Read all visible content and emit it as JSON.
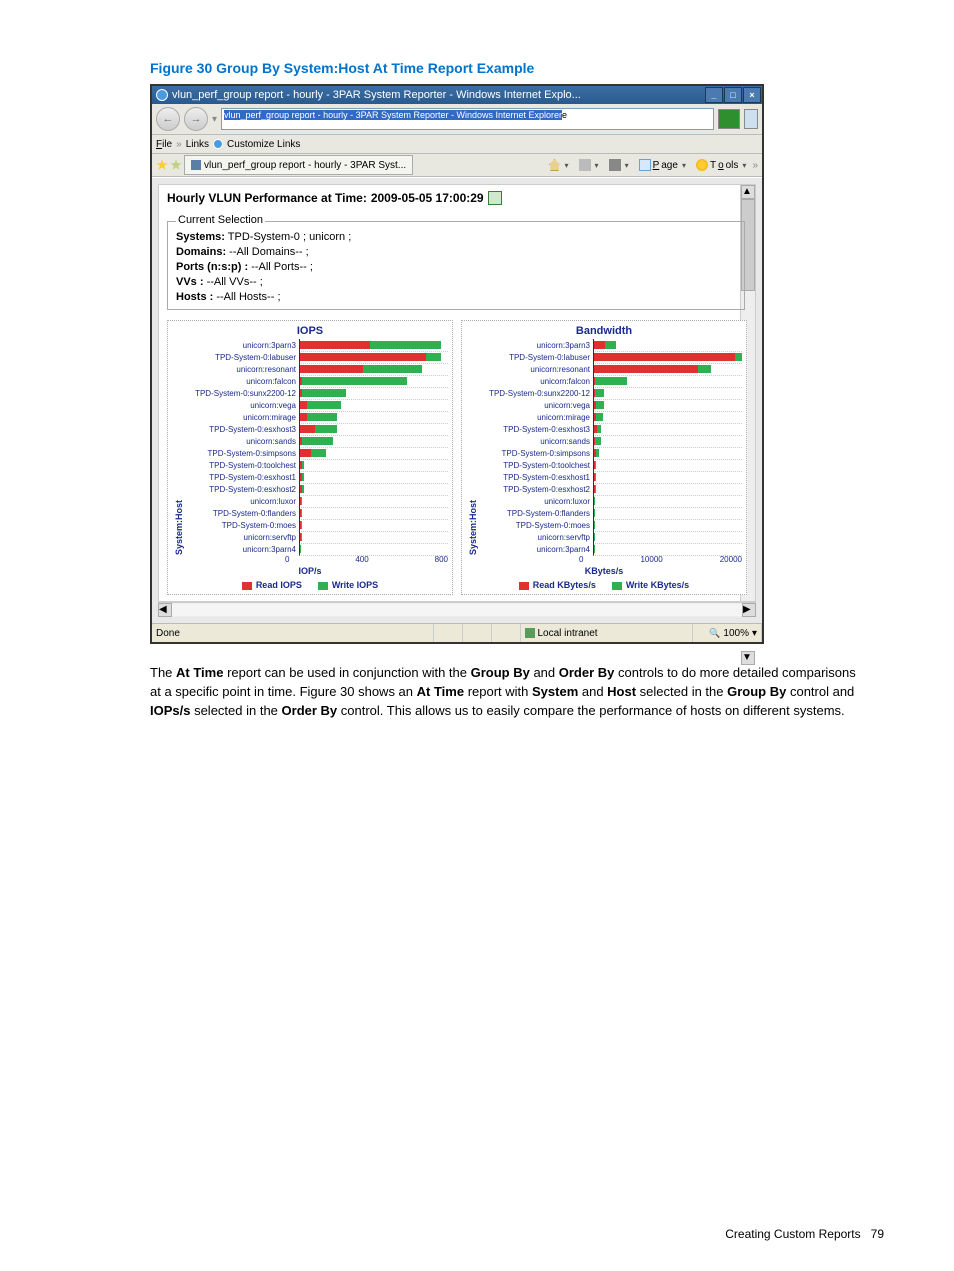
{
  "caption": "Figure 30 Group By System:Host At Time Report Example",
  "window": {
    "title": "vlun_perf_group report - hourly - 3PAR System Reporter - Windows Internet Explo...",
    "address_bar": "vlun_perf_group report - hourly - 3PAR System Reporter - Windows Internet Explorer",
    "menu_file": "File",
    "menu_links": "Links",
    "menu_customize": "Customize Links",
    "tab": "vlun_perf_group report - hourly - 3PAR Syst...",
    "tb_page": "Page",
    "tb_tools": "Tools",
    "status_done": "Done",
    "status_zone": "Local intranet",
    "status_zoom": "100%"
  },
  "report": {
    "title_prefix": "Hourly VLUN Performance at Time: ",
    "title_time": "2009-05-05 17:00:29",
    "sel_legend": "Current Selection",
    "sel_systems_key": "Systems:",
    "sel_systems_val": " TPD-System-0 ; unicorn ;",
    "sel_domains_key": "Domains:",
    "sel_domains_val": " --All Domains-- ;",
    "sel_ports_key": "Ports (n:s:p) :",
    "sel_ports_val": " --All Ports-- ;",
    "sel_vvs_key": "VVs :",
    "sel_vvs_val": " --All VVs-- ;",
    "sel_hosts_key": "Hosts :",
    "sel_hosts_val": " --All Hosts-- ;"
  },
  "chart_data": [
    {
      "type": "bar",
      "title": "IOPS",
      "xlabel": "IOP/s",
      "ylabel": "System:Host",
      "xlim": [
        0,
        800
      ],
      "xticks": [
        "0",
        "400",
        "800"
      ],
      "categories": [
        "unicorn:3parn3",
        "TPD-System-0:labuser",
        "unicorn:resonant",
        "unicorn:falcon",
        "TPD-System-0:sunx2200-12",
        "unicorn:vega",
        "unicorn:mirage",
        "TPD-System-0:esxhost3",
        "unicorn:sands",
        "TPD-System-0:simpsons",
        "TPD-System-0:toolchest",
        "TPD-System-0:esxhost1",
        "TPD-System-0:esxhost2",
        "unicorn:luxor",
        "TPD-System-0:flanders",
        "TPD-System-0:moes",
        "unicorn:servftp",
        "unicorn:3parn4"
      ],
      "series": [
        {
          "name": "Read IOPS",
          "color": "#e03030",
          "values": [
            380,
            680,
            340,
            10,
            10,
            40,
            40,
            80,
            10,
            60,
            10,
            10,
            10,
            5,
            5,
            5,
            5,
            2
          ]
        },
        {
          "name": "Write IOPS",
          "color": "#30b050",
          "values": [
            380,
            80,
            320,
            570,
            240,
            180,
            160,
            120,
            170,
            80,
            10,
            10,
            10,
            5,
            5,
            5,
            5,
            3
          ]
        }
      ]
    },
    {
      "type": "bar",
      "title": "Bandwidth",
      "xlabel": "KBytes/s",
      "ylabel": "System:Host",
      "xlim": [
        0,
        20000
      ],
      "xticks": [
        "0",
        "10000",
        "20000"
      ],
      "categories": [
        "unicorn:3parn3",
        "TPD-System-0:labuser",
        "unicorn:resonant",
        "unicorn:falcon",
        "TPD-System-0:sunx2200-12",
        "unicorn:vega",
        "unicorn:mirage",
        "TPD-System-0:esxhost3",
        "unicorn:sands",
        "TPD-System-0:simpsons",
        "TPD-System-0:toolchest",
        "TPD-System-0:esxhost1",
        "TPD-System-0:esxhost2",
        "unicorn:luxor",
        "TPD-System-0:flanders",
        "TPD-System-0:moes",
        "unicorn:servftp",
        "unicorn:3parn4"
      ],
      "series": [
        {
          "name": "Read KBytes/s",
          "color": "#e03030",
          "values": [
            1500,
            19000,
            14000,
            200,
            200,
            300,
            300,
            400,
            100,
            300,
            100,
            100,
            100,
            50,
            50,
            50,
            50,
            30
          ]
        },
        {
          "name": "Write KBytes/s",
          "color": "#30b050",
          "values": [
            1500,
            1000,
            1800,
            4200,
            1100,
            1000,
            900,
            600,
            900,
            400,
            100,
            100,
            100,
            50,
            50,
            50,
            50,
            30
          ]
        }
      ]
    }
  ],
  "body": {
    "p1_a": "The ",
    "p1_b": "At Time",
    "p1_c": " report can be used in conjunction with the ",
    "p1_d": "Group By",
    "p1_e": " and ",
    "p1_f": "Order By",
    "p1_g": " controls to do more detailed comparisons at a specific point in time. Figure 30 shows an ",
    "p1_h": "At Time",
    "p1_i": " report with ",
    "p1_j": "System",
    "p1_k": " and ",
    "p1_l": "Host",
    "p1_m": " selected in the ",
    "p1_n": "Group By",
    "p1_o": " control and ",
    "p1_p": "IOPs/s",
    "p1_q": " selected in the ",
    "p1_r": "Order By",
    "p1_s": " control. This allows us to easily compare the performance of hosts on different systems."
  },
  "footer": {
    "label": "Creating Custom Reports",
    "page": "79"
  }
}
